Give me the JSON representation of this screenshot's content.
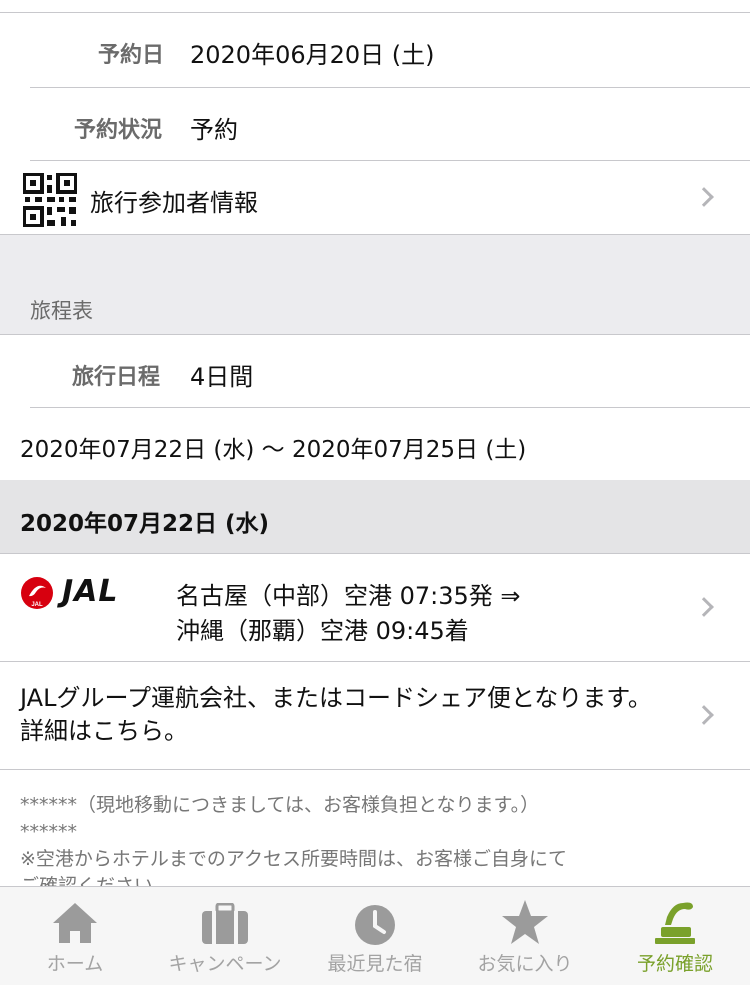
{
  "booking": {
    "date_label": "予約日",
    "date_value": "2020年06月20日 (土)",
    "status_label": "予約状況",
    "status_value": "予約",
    "participants_label": "旅行参加者情報"
  },
  "itinerary": {
    "section_title": "旅程表",
    "duration_label": "旅行日程",
    "duration_value": "4日間",
    "range": "2020年07月22日 (水) 〜 2020年07月25日 (土)",
    "day_header": "2020年07月22日 (水)",
    "flight": {
      "airline_logo_text": "JAL",
      "line1": "名古屋（中部）空港 07:35発 ⇒",
      "line2": "沖縄（那覇）空港 09:45着"
    },
    "notice": "JALグループ運航会社、またはコードシェア便となります。詳細はこちら。",
    "notes": [
      "******（現地移動につきましては、お客様負担となります。）",
      "******",
      "※空港からホテルまでのアクセス所要時間は、お客様ご自身にて",
      "ご確認ください。"
    ]
  },
  "tabbar": {
    "items": [
      {
        "label": "ホーム",
        "icon": "home-icon"
      },
      {
        "label": "キャンペーン",
        "icon": "suitcase-icon"
      },
      {
        "label": "最近見た宿",
        "icon": "clock-icon"
      },
      {
        "label": "お気に入り",
        "icon": "star-icon"
      },
      {
        "label": "予約確認",
        "icon": "phone-icon"
      }
    ],
    "active_color": "#7aa12b",
    "inactive_color": "#a3a3a3"
  }
}
